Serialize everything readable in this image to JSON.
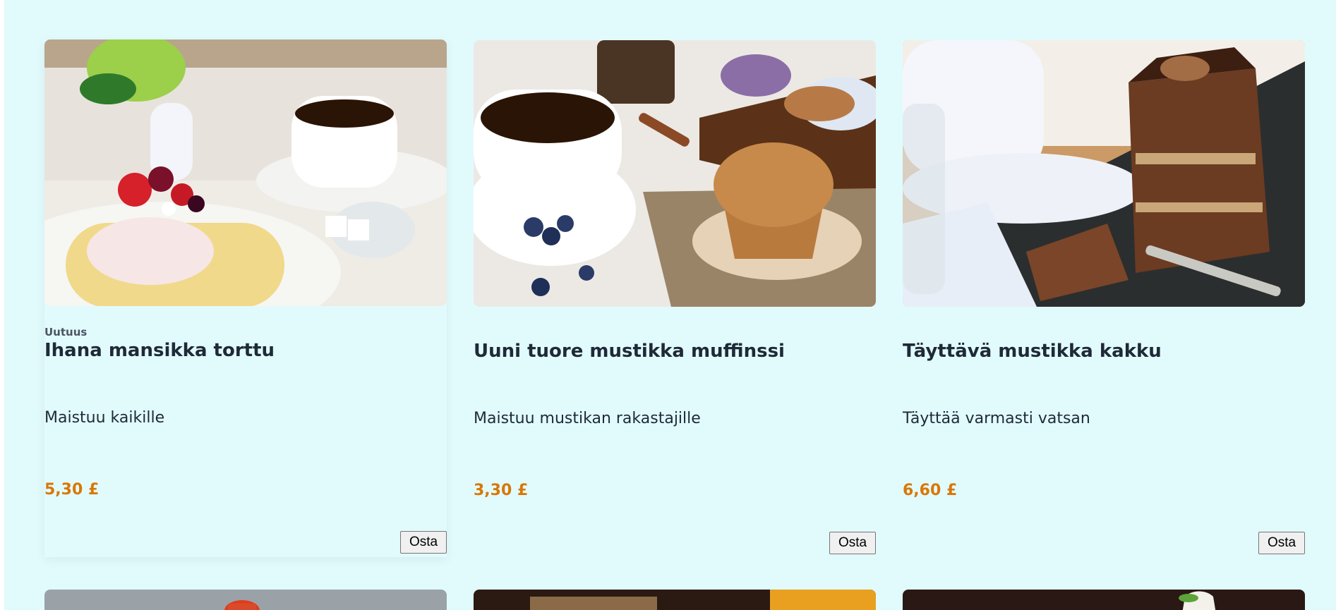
{
  "products": [
    {
      "badge": "Uutuus",
      "title": "Ihana mansikka torttu",
      "description": "Maistuu kaikille",
      "price": "5,30 £",
      "buy_label": "Osta",
      "image_alt": "Strawberry roll cake with coffee"
    },
    {
      "badge": "",
      "title": "Uuni tuore mustikka muffinssi",
      "description": "Maistuu mustikan rakastajille",
      "price": "3,30 £",
      "buy_label": "Osta",
      "image_alt": "Blueberry muffin with coffee"
    },
    {
      "badge": "",
      "title": "Täyttävä mustikka kakku",
      "description": "Täyttää varmasti vatsan",
      "price": "6,60 £",
      "buy_label": "Osta",
      "image_alt": "Chocolate layer cake slice"
    }
  ],
  "colors": {
    "page_background": "#e1fbfd",
    "price": "#d97706",
    "title": "#1f2937"
  }
}
